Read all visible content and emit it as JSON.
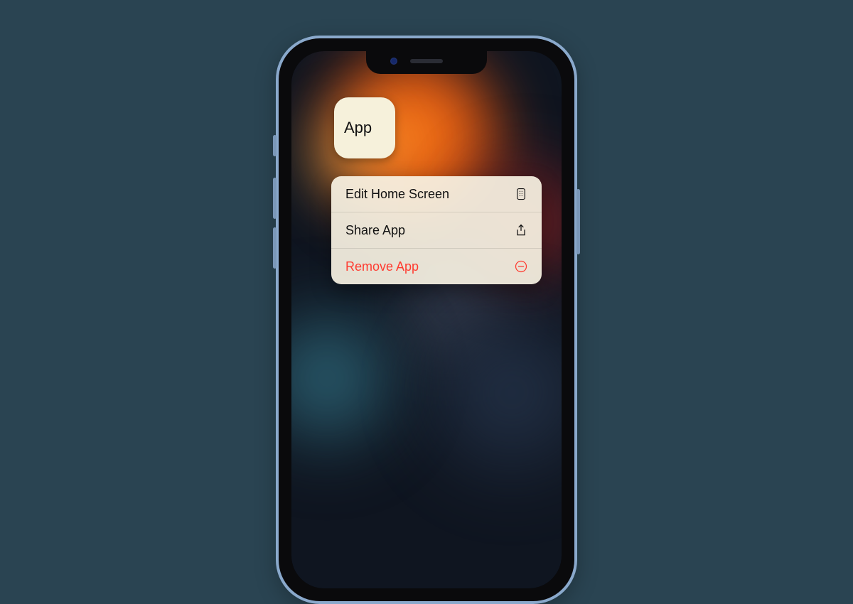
{
  "app_icon": {
    "label": "App"
  },
  "context_menu": {
    "items": [
      {
        "label": "Edit Home Screen",
        "icon": "apps-grid-icon",
        "destructive": false
      },
      {
        "label": "Share App",
        "icon": "share-icon",
        "destructive": false
      },
      {
        "label": "Remove App",
        "icon": "minus-circle-icon",
        "destructive": true
      }
    ]
  },
  "colors": {
    "background": "#2a4452",
    "phone_frame": "#8aa9cc",
    "menu_bg": "#f6f1db",
    "destructive": "#ff3b30"
  }
}
